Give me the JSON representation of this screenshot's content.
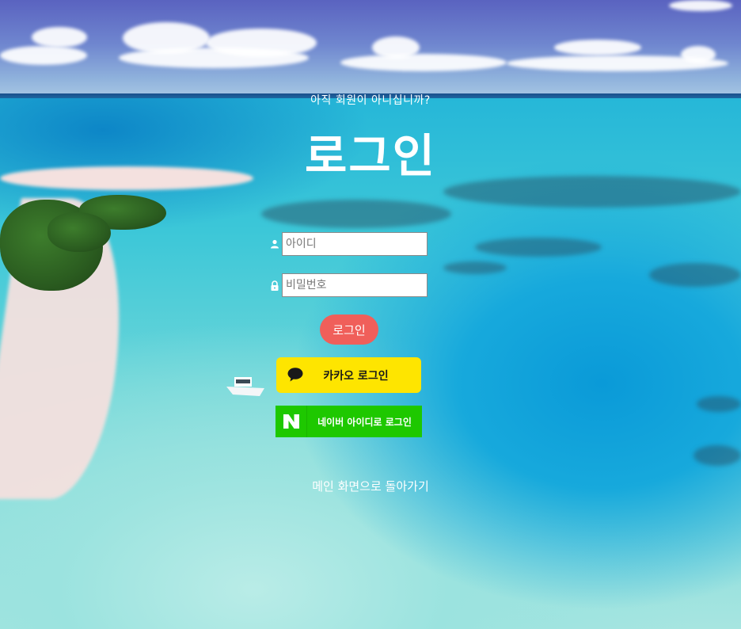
{
  "header": {
    "signup_hint": "아직 회원이 아니십니까?",
    "title": "로그인"
  },
  "form": {
    "id_field": {
      "placeholder": "아이디",
      "value": "",
      "icon": "user-icon"
    },
    "password_field": {
      "placeholder": "비밀번호",
      "value": "",
      "icon": "lock-icon"
    },
    "login_label": "로그인"
  },
  "social": {
    "kakao_label": "카카오 로그인",
    "kakao_icon": "speech-bubble-icon",
    "naver_label": "네이버 아이디로 로그인",
    "naver_icon": "naver-n-icon",
    "naver_letter": "N"
  },
  "footer": {
    "back_link": "메인 화면으로 돌아가기"
  },
  "colors": {
    "login_button": "#f05f5a",
    "kakao": "#fee500",
    "naver": "#1ec800",
    "text": "#ffffff"
  }
}
